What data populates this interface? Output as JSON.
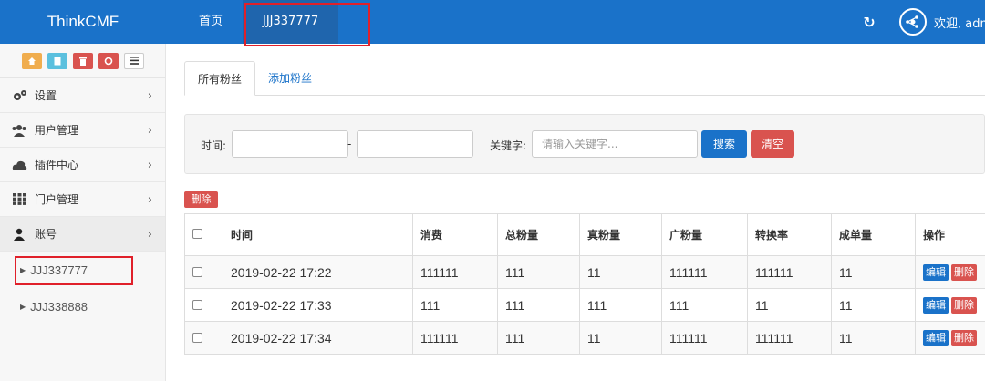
{
  "header": {
    "brand": "ThinkCMF",
    "nav": [
      {
        "label": "首页"
      },
      {
        "label": "JJJ337777"
      }
    ],
    "welcome": "欢迎, admin",
    "color": "#1a72c9"
  },
  "sidebar": {
    "quick_buttons": [
      {
        "icon": "home-icon",
        "color": "#f0ad4e"
      },
      {
        "icon": "file-icon",
        "color": "#5bc0de"
      },
      {
        "icon": "trash-icon",
        "color": "#d9534f"
      },
      {
        "icon": "recycle-icon",
        "color": "#d9534f"
      },
      {
        "icon": "list-icon",
        "color": "#ffffff"
      }
    ],
    "menu": [
      {
        "label": "设置",
        "icon": "gears-icon"
      },
      {
        "label": "用户管理",
        "icon": "users-icon"
      },
      {
        "label": "插件中心",
        "icon": "cloud-icon"
      },
      {
        "label": "门户管理",
        "icon": "grid-icon"
      },
      {
        "label": "账号",
        "icon": "user-icon"
      }
    ],
    "sub_items": [
      {
        "label": "JJJ337777"
      },
      {
        "label": "JJJ338888"
      }
    ]
  },
  "tabs": [
    {
      "label": "所有粉丝"
    },
    {
      "label": "添加粉丝"
    }
  ],
  "filter": {
    "time_label": "时间:",
    "dash": "-",
    "keyword_label": "关键字:",
    "keyword_placeholder": "请输入关键字...",
    "search_label": "搜索",
    "clear_label": "清空"
  },
  "delete_label": "删除",
  "table": {
    "headers": [
      "",
      "时间",
      "消费",
      "总粉量",
      "真粉量",
      "广粉量",
      "转换率",
      "成单量",
      "操作"
    ],
    "rows": [
      [
        "2019-02-22 17:22",
        "111111",
        "111",
        "11",
        "111111",
        "111111",
        "11"
      ],
      [
        "2019-02-22 17:33",
        "111",
        "111",
        "111",
        "111",
        "11",
        "11"
      ],
      [
        "2019-02-22 17:34",
        "111111",
        "111",
        "11",
        "111111",
        "111111",
        "11"
      ]
    ],
    "edit_label": "编辑",
    "row_delete_label": "删除"
  }
}
